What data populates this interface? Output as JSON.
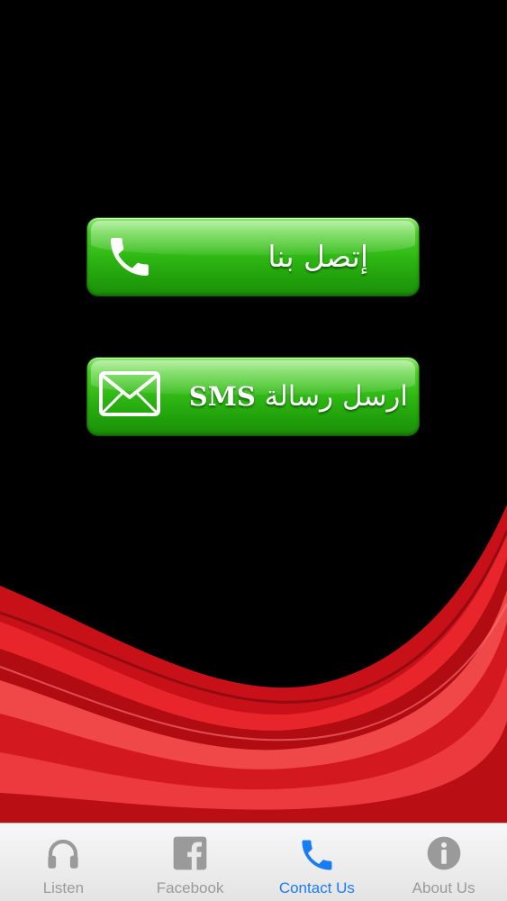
{
  "buttons": {
    "call": {
      "label": "إتصل بنا",
      "icon": "phone-icon"
    },
    "sms": {
      "label_ar": "ارسل رسالة",
      "label_en": "SMS",
      "icon": "envelope-icon"
    }
  },
  "tabbar": {
    "tabs": [
      {
        "label": "Listen",
        "icon": "headphones-icon",
        "active": false
      },
      {
        "label": "Facebook",
        "icon": "facebook-icon",
        "active": false
      },
      {
        "label": "Contact Us",
        "icon": "phone-icon",
        "active": true
      },
      {
        "label": "About Us",
        "icon": "info-icon",
        "active": false
      }
    ]
  },
  "colors": {
    "background": "#000000",
    "button_green": "#2fb814",
    "wave_red": "#e8252b",
    "tab_active": "#1a7cf3",
    "tab_inactive": "#9a9a9a"
  }
}
